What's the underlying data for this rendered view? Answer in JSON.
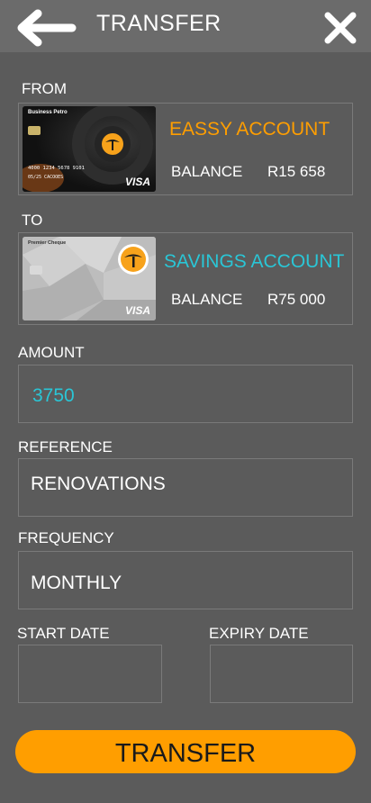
{
  "header": {
    "title": "TRANSFER"
  },
  "from": {
    "label": "FROM",
    "card_brand": "Business Petro",
    "card_number": "4000 1234 5678 9101",
    "card_extra": "05/25  CACOOES",
    "card_network": "VISA",
    "account_name": "EASSY ACCOUNT",
    "balance_label": "BALANCE",
    "balance_value": "R15 658"
  },
  "to": {
    "label": "TO",
    "card_brand": "Premier Cheque",
    "card_network": "VISA",
    "account_name": "SAVINGS ACCOUNT",
    "balance_label": "BALANCE",
    "balance_value": "R75 000"
  },
  "amount": {
    "label": "AMOUNT",
    "value": "3750"
  },
  "reference": {
    "label": "REFERENCE",
    "value": "RENOVATIONS"
  },
  "frequency": {
    "label": "FREQUENCY",
    "value": "MONTHLY"
  },
  "start_date": {
    "label": "START DATE",
    "value": ""
  },
  "expiry_date": {
    "label": "EXPIRY DATE",
    "value": ""
  },
  "submit": {
    "label": "TRANSFER"
  },
  "colors": {
    "background": "#5b5b5b",
    "header": "#6b6b6b",
    "orange": "#ff9e00",
    "teal": "#2ac6d6"
  }
}
